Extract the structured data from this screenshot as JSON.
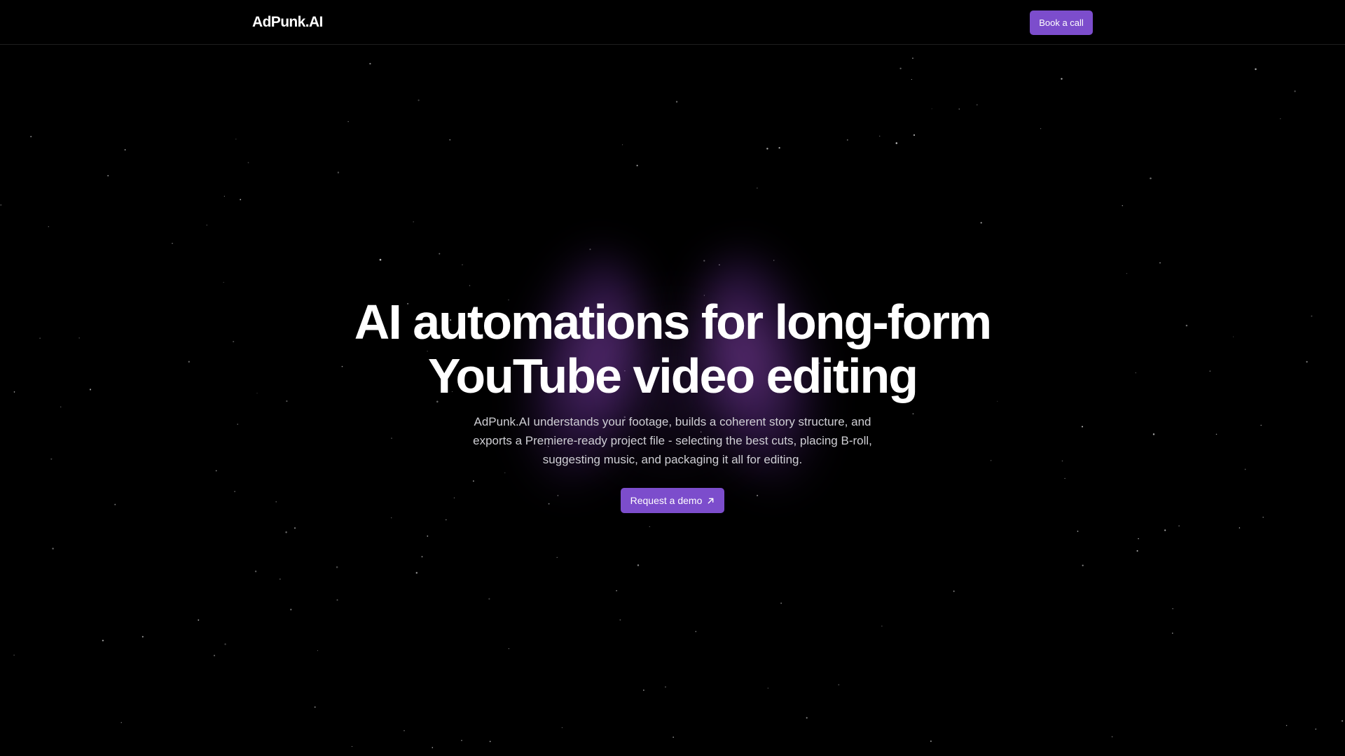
{
  "brand": {
    "name": "AdPunk.AI"
  },
  "nav": {
    "cta_label": "Book a call"
  },
  "hero": {
    "title_line1": "AI automations for long-form",
    "title_line2": "YouTube video editing",
    "subtitle_line1": "AdPunk.AI understands your footage, builds a coherent story structure, and",
    "subtitle_line2": "exports a Premiere-ready project file - selecting the best cuts, placing B-roll,",
    "subtitle_line3": "suggesting music, and packaging it all for editing.",
    "cta_label": "Request a demo",
    "cta_icon": "arrow-up-right-icon"
  },
  "colors": {
    "background": "#000000",
    "accent": "#7c4dcc",
    "text_primary": "#ffffff",
    "text_secondary": "#cfcfd4",
    "glow": "#9b55d2"
  }
}
